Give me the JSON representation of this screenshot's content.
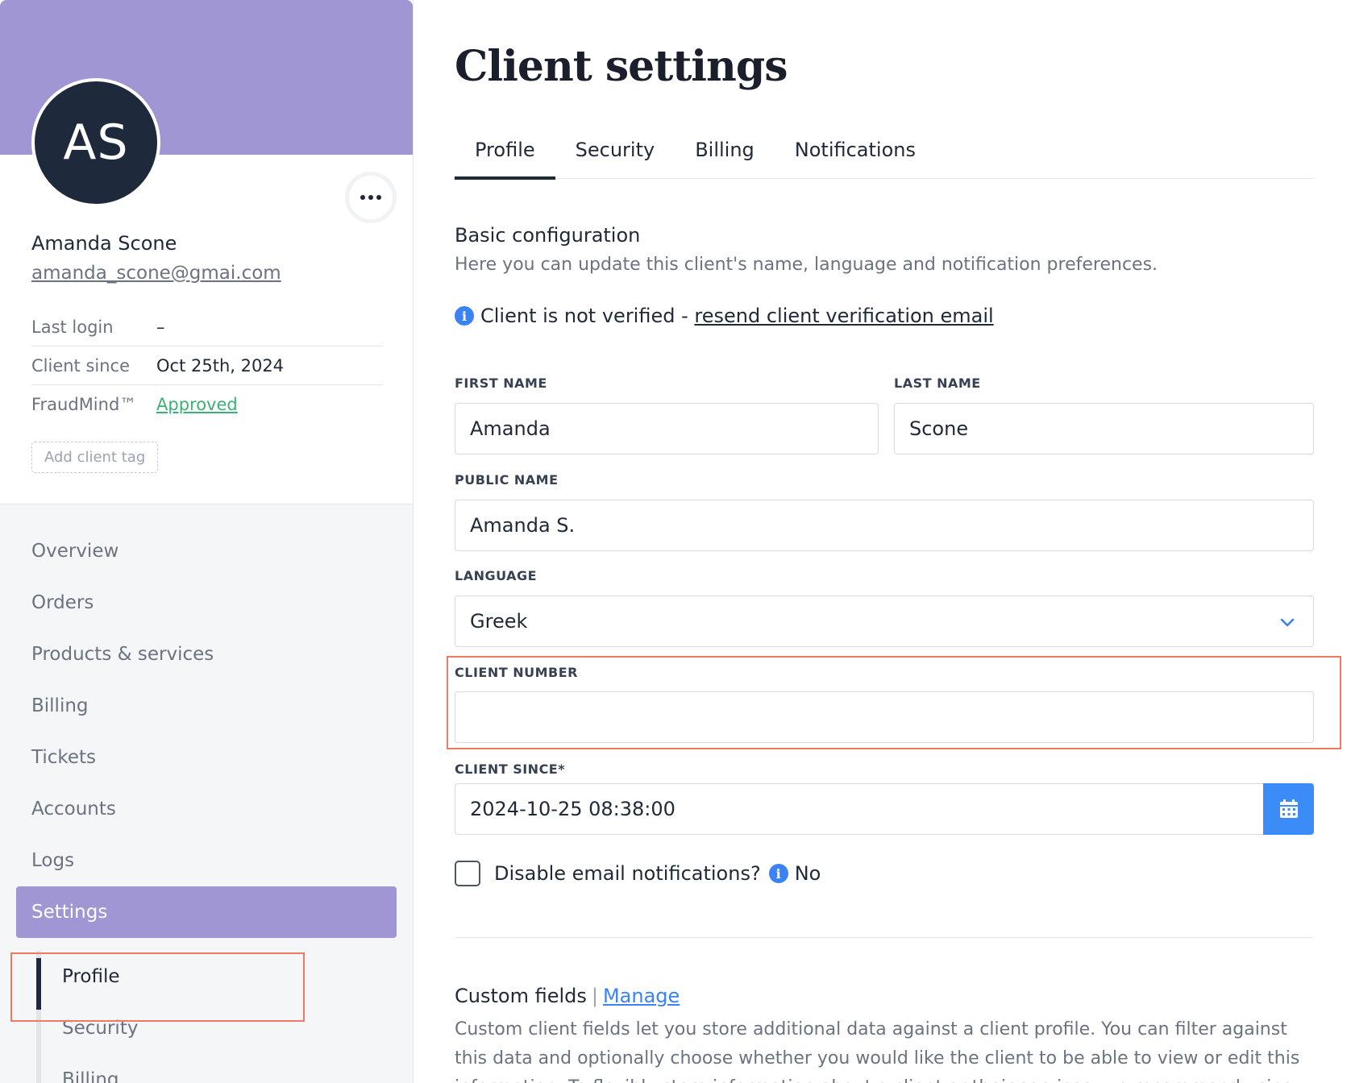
{
  "sidebar": {
    "avatar_initials": "AS",
    "client_name": "Amanda Scone",
    "client_email": "amanda_scone@gmai.com",
    "meta": {
      "last_login_label": "Last login",
      "last_login_value": "–",
      "client_since_label": "Client since",
      "client_since_value": "Oct 25th, 2024",
      "fraudmind_label": "FraudMind™",
      "fraudmind_value": "Approved"
    },
    "add_tag_label": "Add client tag",
    "nav": [
      "Overview",
      "Orders",
      "Products & services",
      "Billing",
      "Tickets",
      "Accounts",
      "Logs",
      "Settings"
    ],
    "active_nav": "Settings",
    "subnav": [
      "Profile",
      "Security",
      "Billing"
    ],
    "active_subnav": "Profile"
  },
  "main": {
    "title": "Client settings",
    "tabs": [
      "Profile",
      "Security",
      "Billing",
      "Notifications"
    ],
    "active_tab": "Profile",
    "section_title": "Basic configuration",
    "section_desc": "Here you can update this client's name, language and notification preferences.",
    "verify_text": "Client is not verified - ",
    "verify_link": "resend client verification email",
    "fields": {
      "first_name_label": "FIRST NAME",
      "first_name_value": "Amanda",
      "last_name_label": "LAST NAME",
      "last_name_value": "Scone",
      "public_name_label": "PUBLIC NAME",
      "public_name_value": "Amanda S.",
      "language_label": "LANGUAGE",
      "language_value": "Greek",
      "client_number_label": "CLIENT NUMBER",
      "client_number_value": "",
      "client_since_label": "CLIENT SINCE*",
      "client_since_value": "2024-10-25 08:38:00"
    },
    "disable_email_label": "Disable email notifications?",
    "disable_email_value": "No",
    "custom_fields_title": "Custom fields",
    "custom_fields_link": "Manage",
    "custom_fields_desc": "Custom client fields let you store additional data against a client profile. You can filter against this data and optionally choose whether you would like the client to be able to view or edit this information. To flexibly store information about a client or their services, we recommend using"
  },
  "colors": {
    "accent_purple": "#a096d4",
    "avatar_bg": "#1e2a3b",
    "approved_green": "#3bb273",
    "info_blue": "#3b82f6",
    "highlight_red": "#ef7a64"
  },
  "icons": {
    "more": "more-horizontal-icon",
    "info": "info-icon",
    "chevron": "chevron-down-icon",
    "calendar": "calendar-icon"
  }
}
